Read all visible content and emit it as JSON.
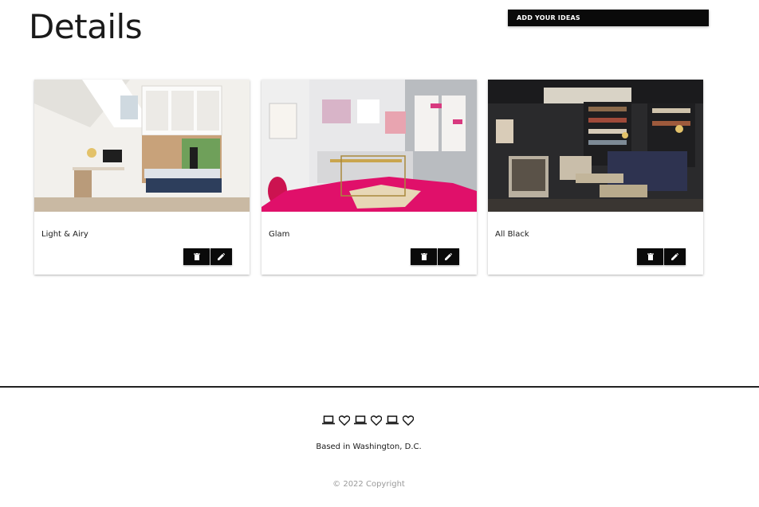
{
  "header": {
    "title": "Details",
    "add_button_label": "ADD YOUR IDEAS"
  },
  "cards": [
    {
      "title": "Light & Airy",
      "image": "bright white home office with window seat"
    },
    {
      "title": "Glam",
      "image": "grey glam office with pink rug"
    },
    {
      "title": "All Black",
      "image": "black library living room"
    }
  ],
  "card_actions": {
    "delete_icon": "trash-icon",
    "edit_icon": "pencil-icon"
  },
  "footer": {
    "icons": [
      "laptop-icon",
      "heart-icon",
      "laptop-icon",
      "heart-icon",
      "laptop-icon",
      "heart-icon"
    ],
    "location": "Based in Washington, D.C.",
    "copyright": "© 2022 Copyright"
  },
  "colors": {
    "button_bg": "#0a0a0a",
    "accent_pink": "#e0106a",
    "divider": "#222222"
  }
}
